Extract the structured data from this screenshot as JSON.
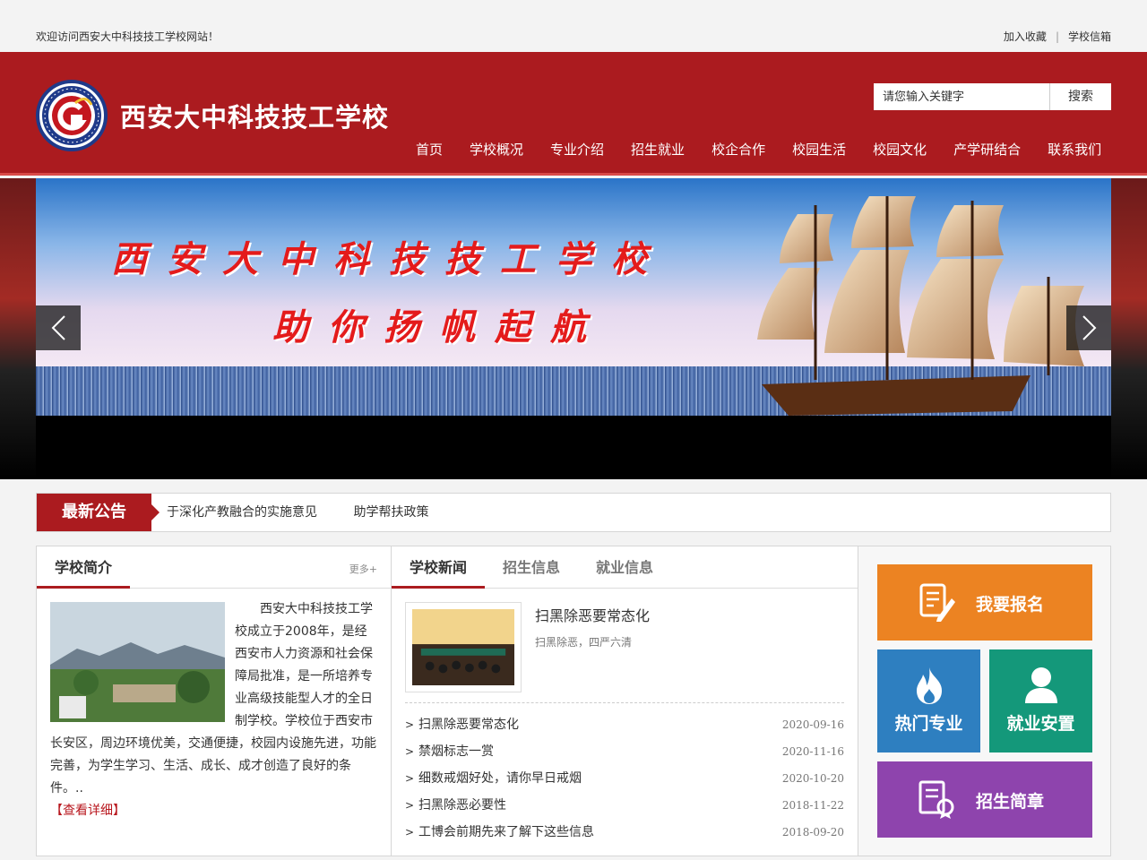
{
  "topbar": {
    "welcome": "欢迎访问西安大中科技技工学校网站！",
    "bookmark": "加入收藏",
    "separator": "|",
    "mailbox": "学校信箱"
  },
  "header": {
    "school_name": "西安大中科技技工学校",
    "search_placeholder": "请您输入关键字",
    "search_button": "搜索"
  },
  "nav": [
    "首页",
    "学校概况",
    "专业介绍",
    "招生就业",
    "校企合作",
    "校园生活",
    "校园文化",
    "产学研结合",
    "联系我们"
  ],
  "banner": {
    "line1": "西安大中科技技工学校",
    "line2": "助你扬帆起航"
  },
  "notice": {
    "label": "最新公告",
    "items": [
      "于深化产教融合的实施意见",
      "助学帮扶政策"
    ]
  },
  "intro": {
    "title": "学校简介",
    "more": "更多+",
    "text": "西安大中科技技工学校成立于2008年，是经西安市人力资源和社会保障局批准，是一所培养专业高级技能型人才的全日制学校。学校位于西安市长安区，周边环境优美，交通便捷，校园内设施先进，功能完善，为学生学习、生活、成长、成才创造了良好的条件。..",
    "detail_link": "【查看详细】"
  },
  "news": {
    "tabs": [
      "学校新闻",
      "招生信息",
      "就业信息"
    ],
    "featured": {
      "title": "扫黑除恶要常态化",
      "subtitle": "扫黑除恶，四严六清"
    },
    "bullet": ">",
    "list": [
      {
        "title": "扫黑除恶要常态化",
        "date": "2020-09-16"
      },
      {
        "title": "禁烟标志一赏",
        "date": "2020-11-16"
      },
      {
        "title": "细数戒烟好处，请你早日戒烟",
        "date": "2020-10-20"
      },
      {
        "title": "扫黑除恶必要性",
        "date": "2018-11-22"
      },
      {
        "title": "工博会前期先来了解下这些信息",
        "date": "2018-09-20"
      }
    ]
  },
  "quick_links": {
    "apply": "我要报名",
    "hot_majors": "热门专业",
    "employment": "就业安置",
    "brochure": "招生简章"
  },
  "colors": {
    "brand_red": "#ab1b1f",
    "tile_orange": "#ec8322",
    "tile_blue": "#2e7fc0",
    "tile_green": "#14987a",
    "tile_purple": "#8e44ad"
  },
  "icons": {
    "prev": "chevron-left-icon",
    "next": "chevron-right-icon",
    "apply": "form-pen-icon",
    "hot": "flame-icon",
    "employment": "user-icon",
    "brochure": "certificate-icon"
  }
}
